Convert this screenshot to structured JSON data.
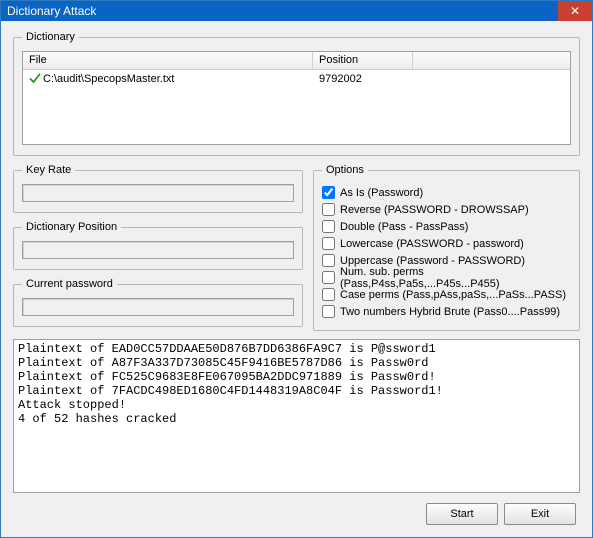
{
  "window": {
    "title": "Dictionary Attack"
  },
  "groups": {
    "dictionary": "Dictionary",
    "keyrate": "Key Rate",
    "dictpos": "Dictionary Position",
    "curpass": "Current password",
    "options": "Options"
  },
  "dictionary": {
    "headers": {
      "file": "File",
      "position": "Position"
    },
    "rows": [
      {
        "file": "C:\\audit\\SpecopsMaster.txt",
        "position": "9792002",
        "checked": true
      }
    ]
  },
  "keyrate": {
    "value": ""
  },
  "dictpos": {
    "value": ""
  },
  "curpass": {
    "value": ""
  },
  "options": {
    "items": [
      {
        "label": "As Is (Password)",
        "checked": true
      },
      {
        "label": "Reverse (PASSWORD - DROWSSAP)",
        "checked": false
      },
      {
        "label": "Double (Pass - PassPass)",
        "checked": false
      },
      {
        "label": "Lowercase (PASSWORD - password)",
        "checked": false
      },
      {
        "label": "Uppercase (Password - PASSWORD)",
        "checked": false
      },
      {
        "label": "Num. sub. perms (Pass,P4ss,Pa5s,...P45s...P455)",
        "checked": false
      },
      {
        "label": "Case perms (Pass,pAss,paSs,...PaSs...PASS)",
        "checked": false
      },
      {
        "label": "Two numbers Hybrid Brute (Pass0....Pass99)",
        "checked": false
      }
    ]
  },
  "output": "Plaintext of EAD0CC57DDAAE50D876B7DD6386FA9C7 is P@ssword1\nPlaintext of A87F3A337D73085C45F9416BE5787D86 is Passw0rd\nPlaintext of FC525C9683E8FE067095BA2DDC971889 is Passw0rd!\nPlaintext of 7FACDC498ED1680C4FD1448319A8C04F is Password1!\nAttack stopped!\n4 of 52 hashes cracked",
  "buttons": {
    "start": "Start",
    "exit": "Exit"
  }
}
